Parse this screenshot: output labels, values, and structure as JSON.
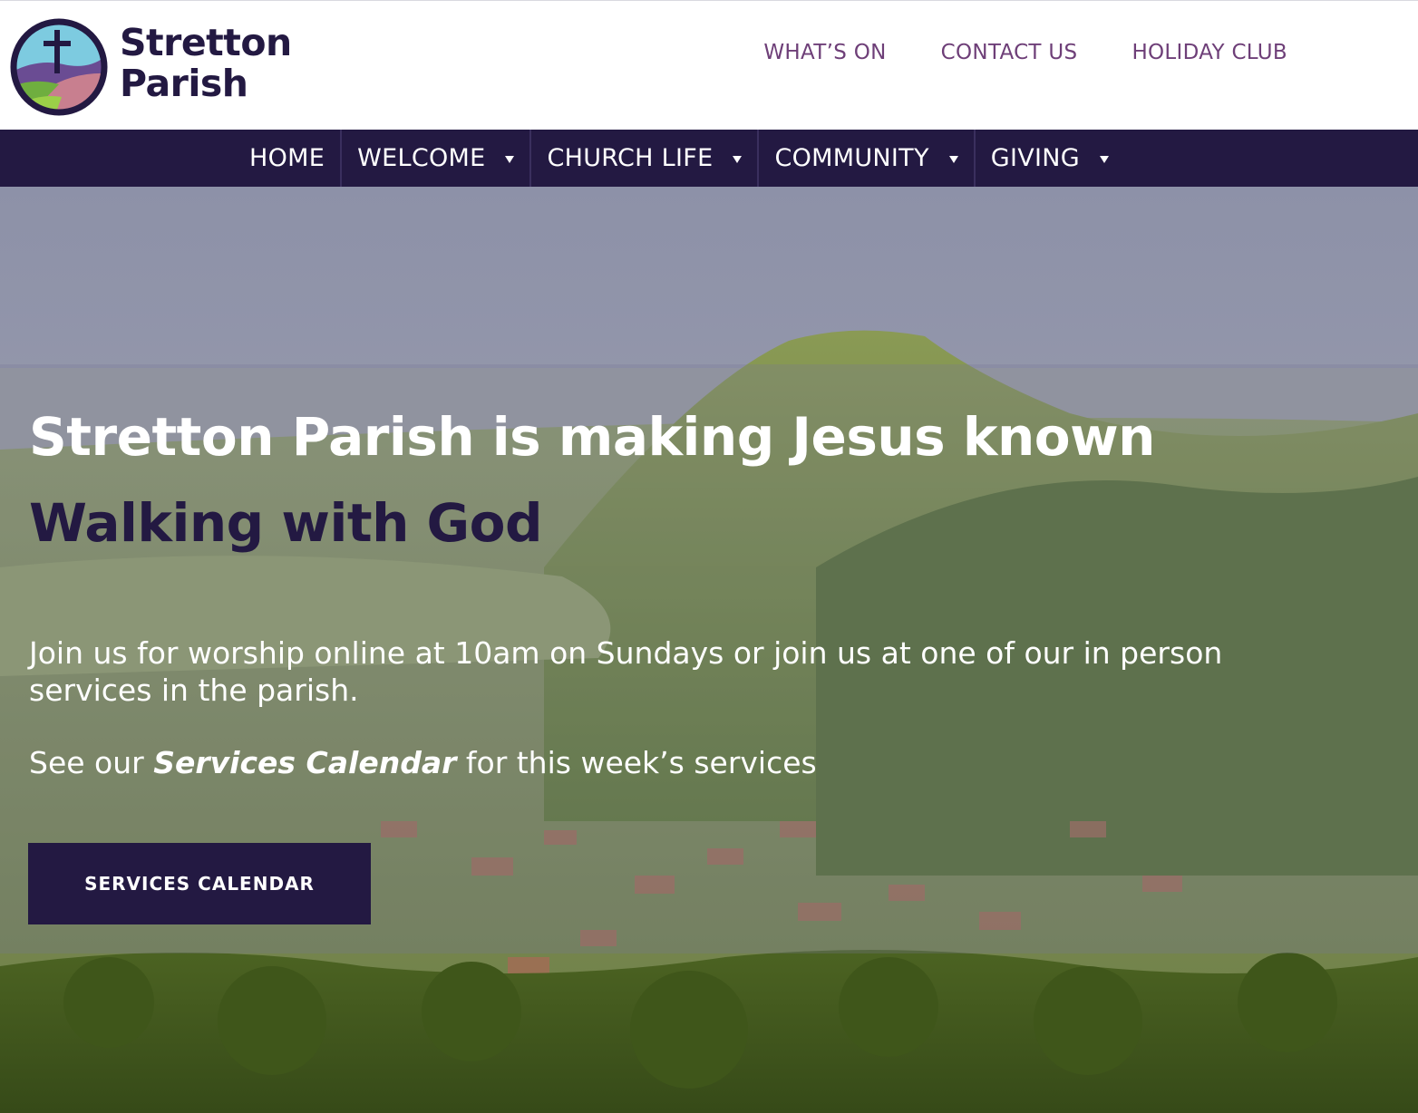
{
  "brand": {
    "name_line1": "Stretton",
    "name_line2": "Parish",
    "colors": {
      "primary": "#231942",
      "accent": "#6e3f78",
      "logo_sky": "#7dcbe0",
      "logo_hill_purple": "#6a4c93",
      "logo_hill_green": "#6fae3f",
      "logo_hill_pink": "#c87f8f"
    }
  },
  "top_links": [
    "WHAT’S ON",
    "CONTACT US",
    "HOLIDAY CLUB"
  ],
  "nav": {
    "items": [
      {
        "label": "HOME",
        "dropdown": false
      },
      {
        "label": "WELCOME",
        "dropdown": true
      },
      {
        "label": "CHURCH LIFE",
        "dropdown": true
      },
      {
        "label": "COMMUNITY",
        "dropdown": true
      },
      {
        "label": "GIVING",
        "dropdown": true
      }
    ]
  },
  "hero": {
    "title": "Stretton Parish is making Jesus known",
    "subtitle": "Walking with God",
    "paragraph": "Join us for worship online at 10am on Sundays or join us at one of our in person services in the parish.",
    "calendar_prefix": "See our ",
    "calendar_link": "Services Calendar",
    "calendar_suffix": " for this week’s services",
    "button_label": "SERVICES CALENDAR"
  }
}
